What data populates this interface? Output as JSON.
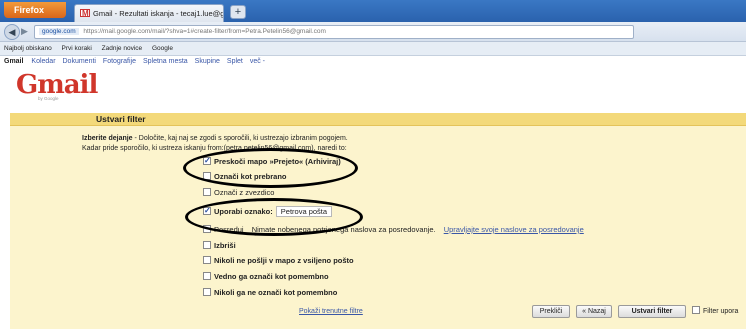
{
  "browser": {
    "menu_label": "Firefox",
    "tab_title": "Gmail - Rezultati iskanja - tecaj1.lue@g...",
    "newtab_label": "+",
    "url_site": "google.com",
    "url_path": "https://mail.google.com/mail/?shva=1#create-filter/from=Petra.Petelin56@gmail.com",
    "bookmarks": [
      "Najbolj obiskano",
      "Prvi koraki",
      "Zadnje novice",
      "Google"
    ]
  },
  "gmail_nav": {
    "active": "Gmail",
    "links": [
      "Koledar",
      "Dokumenti",
      "Fotografije",
      "Spletna mesta",
      "Skupine",
      "Splet",
      "več -"
    ]
  },
  "logo": {
    "text": "Gmail",
    "subtitle": "by Google"
  },
  "filter": {
    "title": "Ustvari filter",
    "intro_bold": "Izberite dejanje",
    "intro_rest": " - Določite, kaj naj se zgodi s sporočili, ki ustrezajo izbranim pogojem.",
    "intro2": "Kadar pride sporočilo, ki ustreza iskanju from:(petra.petelin56@gmail.com), naredi to:",
    "options": {
      "skip_inbox": "Preskoči mapo »Prejeto« (Arhiviraj)",
      "mark_read": "Označi kot prebrano",
      "star": "Označi z zvezdico",
      "apply_label": "Uporabi oznako:",
      "label_value": "Petrova pošta",
      "forward": "Posreduj",
      "forward_note": "Nimate nobenega potrjenega naslova za posredovanje.",
      "forward_link": "Upravljajte svoje naslove za posredovanje",
      "delete": "Izbriši",
      "never_spam": "Nikoli ne pošlji v mapo z vsiljeno pošto",
      "always_important": "Vedno ga označi kot pomembno",
      "never_important": "Nikoli ga ne označi kot pomembno"
    },
    "show_filters_link": "Pokaži trenutne filtre",
    "buttons": {
      "cancel": "Prekliči",
      "back": "« Nazaj",
      "create": "Ustvari filter"
    },
    "footer_option": "Filter upora"
  }
}
